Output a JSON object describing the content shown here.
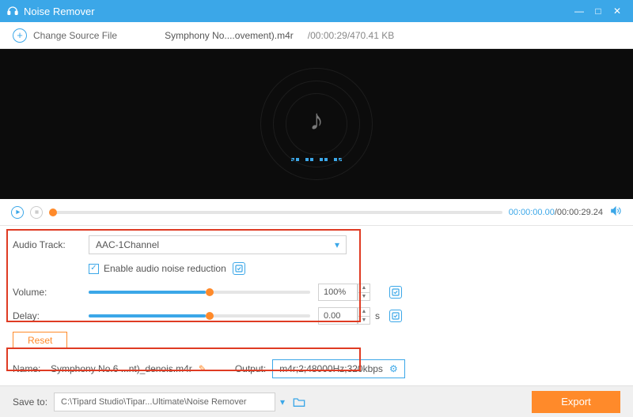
{
  "app": {
    "title": "Noise Remover"
  },
  "window_buttons": {
    "min": "—",
    "max": "□",
    "close": "✕"
  },
  "toolbar": {
    "change_source_label": "Change Source File",
    "file_name": "Symphony No....ovement).m4r",
    "file_meta": "/00:00:29/470.41 KB"
  },
  "player": {
    "time_current": "00:00:00.00",
    "time_total": "/00:00:29.24"
  },
  "settings": {
    "audio_track_label": "Audio Track:",
    "audio_track_value": "AAC-1Channel",
    "enable_noise_label": "Enable audio noise reduction",
    "volume_label": "Volume:",
    "volume_value": "100%",
    "delay_label": "Delay:",
    "delay_value": "0.00",
    "delay_unit": "s",
    "reset_label": "Reset"
  },
  "output": {
    "name_label": "Name:",
    "name_value": "Symphony No.6 ...nt)_denois.m4r",
    "output_label": "Output:",
    "output_value": "m4r;2;48000Hz;320kbps"
  },
  "footer": {
    "save_label": "Save to:",
    "save_path": "C:\\Tipard Studio\\Tipar...Ultimate\\Noise Remover",
    "export_label": "Export"
  },
  "icons": {
    "headphones": "headphones-icon",
    "plus": "+",
    "play": "▶",
    "stop": "■",
    "speaker": "🔊",
    "check": "✓",
    "caret": "▾",
    "up": "▲",
    "down": "▼",
    "pencil": "✎",
    "gear": "⚙",
    "folder": "▭",
    "note": "♪"
  }
}
